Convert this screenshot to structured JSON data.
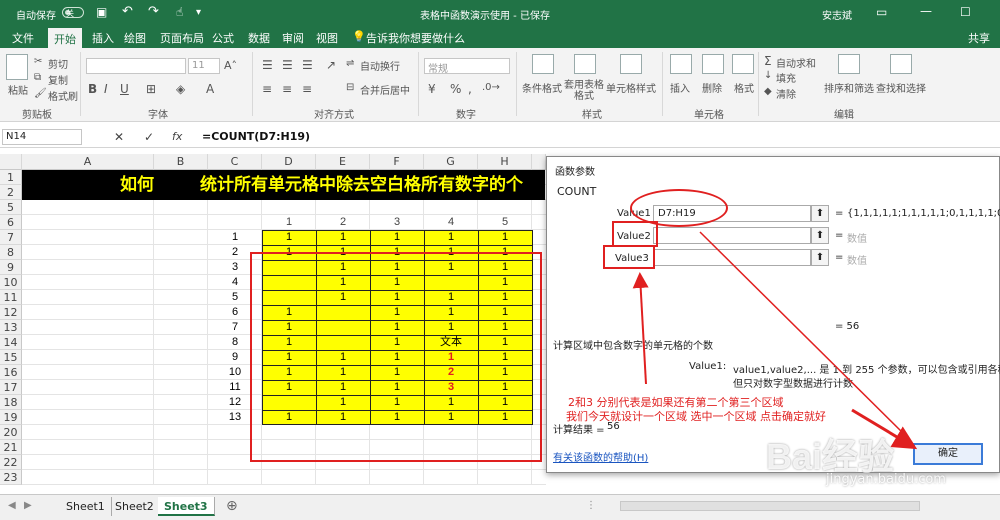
{
  "titlebar": {
    "autosave": "自动保存",
    "off": "关",
    "doc_title": "表格中函数演示使用 - 已保存",
    "user": "安志斌"
  },
  "tabs": [
    "文件",
    "开始",
    "插入",
    "绘图",
    "页面布局",
    "公式",
    "数据",
    "审阅",
    "视图"
  ],
  "tell_me": "告诉我你想要做什么",
  "share": "共享",
  "ribbon": {
    "paste": "粘贴",
    "cut": "剪切",
    "copy": "复制",
    "format_painter": "格式刷",
    "clipboard": "剪贴板",
    "font_size": "11",
    "bold": "B",
    "italic": "I",
    "underline": "U",
    "font_group": "字体",
    "wrap_text": "自动换行",
    "merge_center": "合并后居中",
    "align_group": "对齐方式",
    "number_format": "常规",
    "percent": "%",
    "number_group": "数字",
    "cond_format": "条件格式",
    "table_format": "套用表格格式",
    "cell_styles": "单元格样式",
    "styles_group": "样式",
    "insert": "插入",
    "delete": "删除",
    "format": "格式",
    "cells_group": "单元格",
    "autosum": "自动求和",
    "fill": "填充",
    "clear": "清除",
    "sort_filter": "排序和筛选",
    "find_select": "查找和选择",
    "edit_group": "编辑"
  },
  "formula_bar": {
    "name_box": "N14",
    "cancel": "✕",
    "enter": "✓",
    "fx": "fx",
    "formula": "=COUNT(D7:H19)"
  },
  "columns": [
    "A",
    "B",
    "C",
    "D",
    "E",
    "F",
    "G",
    "H"
  ],
  "rows": [
    "1",
    "2",
    "5",
    "6",
    "7",
    "8",
    "9",
    "10",
    "11",
    "12",
    "13",
    "14",
    "15",
    "16",
    "17",
    "18",
    "19",
    "20",
    "21",
    "22",
    "23"
  ],
  "banner": {
    "part1": "如何",
    "part2": "统计所有单元格中除去空白格所有数字的个"
  },
  "header_nums": [
    "1",
    "2",
    "3",
    "4",
    "5"
  ],
  "row_labels": [
    "1",
    "2",
    "3",
    "4",
    "5",
    "6",
    "7",
    "8",
    "9",
    "10",
    "11",
    "12",
    "13"
  ],
  "table": [
    [
      "1",
      "1",
      "1",
      "1",
      "1"
    ],
    [
      "1",
      "1",
      "1",
      "1",
      "1"
    ],
    [
      "",
      "1",
      "1",
      "1",
      "1"
    ],
    [
      "",
      "1",
      "1",
      "",
      "1"
    ],
    [
      "",
      "1",
      "1",
      "1",
      "1"
    ],
    [
      "1",
      "",
      "1",
      "1",
      "1"
    ],
    [
      "1",
      "",
      "1",
      "1",
      "1"
    ],
    [
      "1",
      "",
      "1",
      "文本",
      "1"
    ],
    [
      "1",
      "1",
      "1",
      "1",
      "1"
    ],
    [
      "1",
      "1",
      "1",
      "2",
      "1"
    ],
    [
      "1",
      "1",
      "1",
      "3",
      "1"
    ],
    [
      "",
      "1",
      "1",
      "1",
      "1"
    ],
    [
      "1",
      "1",
      "1",
      "1",
      "1"
    ]
  ],
  "red_cells": [
    "9-3",
    "10-3",
    "11-3"
  ],
  "sheets": [
    "Sheet1",
    "Sheet2",
    "Sheet3"
  ],
  "dialog": {
    "title": "函数参数",
    "func_name": "COUNT",
    "value1_label": "Value1",
    "value1": "D7:H19",
    "value1_result": "{1,1,1,1,1;1,1,1,1,1;0,1,1,1,1;0,1,1,0,",
    "value2_label": "Value2",
    "value3_label": "Value3",
    "placeholder_result": "数值",
    "equals": "=",
    "total": "= 56",
    "desc": "计算区域中包含数字的单元格的个数",
    "arg_name": "Value1:",
    "arg_desc1": "value1,value2,... 是 1 到 255 个参数，可以包含或引用各种不同类",
    "arg_desc2": "但只对数字型数据进行计数",
    "result_label": "计算结果 =",
    "result_value": "56",
    "help_link": "有关该函数的帮助(H)",
    "ok": "确定"
  },
  "annotation": {
    "line1": "2和3 分别代表是如果还有第二个第三个区域",
    "line2": "我们今天就设计一个区域 选中一个区域 点击确定就好"
  },
  "watermark": {
    "brand": "Bai经验",
    "url": "jingyan.baidu.com"
  },
  "colors": {
    "excel_green": "#217346",
    "highlight_yellow": "#ffff00",
    "annotation_red": "#e02020"
  }
}
